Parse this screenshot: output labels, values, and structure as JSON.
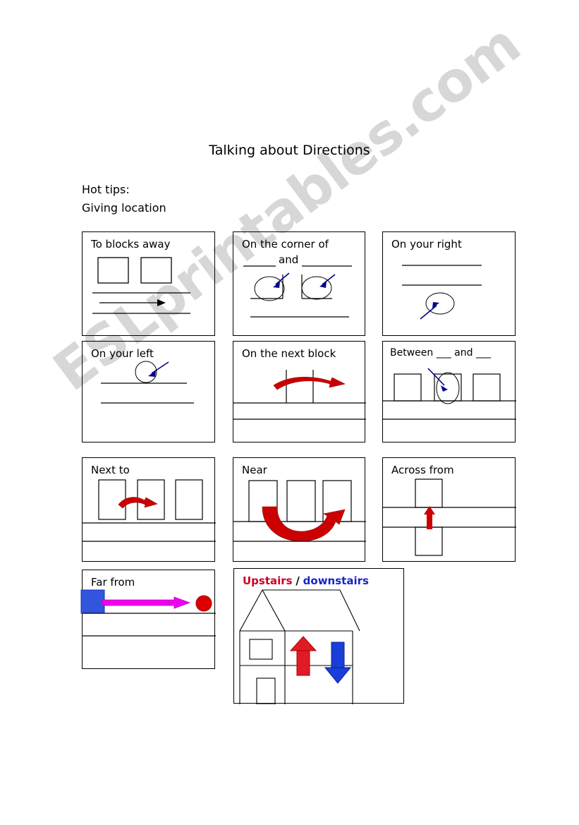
{
  "page": {
    "title": "Talking about Directions",
    "hot_tips_label": "Hot tips:",
    "subtitle": "Giving location",
    "watermark": "ESLprintables.com",
    "background_color": "#ffffff",
    "ink_color": "#000000"
  },
  "colors": {
    "red_arrow": "#cc0000",
    "blue_arrow": "#00008b",
    "magenta_arrow": "#ee00ee",
    "blue_block": "#3355dd",
    "red_circle": "#dd0000",
    "upstairs_text": "#cc0022",
    "downstairs_text": "#1a23c8",
    "watermark_gray": "#c9c9c9"
  },
  "cards": [
    {
      "id": "to-blocks-away",
      "title": "To blocks away",
      "row": 1,
      "column": 1,
      "graphic": "two-blocks-with-street-arrow",
      "description": "Two square blocks above a street with a right-pointing arrow between two road lines"
    },
    {
      "id": "on-the-corner-of",
      "title_line1": "On the corner of",
      "title_line2": "and",
      "title": "On the corner of ___ and ___",
      "row": 1,
      "column": 2,
      "graphic": "two-corners-with-blue-arrows",
      "description": "Two corner blocks each marked with a circle and a blue arrow"
    },
    {
      "id": "on-your-right",
      "title": "On your right",
      "row": 1,
      "column": 3,
      "graphic": "street-with-circle-and-blue-arrow",
      "description": "Two street lines with a circled spot below marked by a blue arrow"
    },
    {
      "id": "on-your-left",
      "title": "On your left",
      "row": 2,
      "column": 1,
      "graphic": "street-with-circle-and-blue-arrow-left",
      "description": "Circle on upper street line marked by a blue arrow"
    },
    {
      "id": "on-the-next-block",
      "title": "On the next block",
      "row": 2,
      "column": 2,
      "graphic": "red-curved-arrow-over-block",
      "description": "Red curved arrow arching over the next block"
    },
    {
      "id": "between-and",
      "title": "Between ___ and ___",
      "row": 2,
      "column": 3,
      "graphic": "three-buildings-with-blue-arrow",
      "description": "Three buildings, a circle around the middle one marked by a blue arrow"
    },
    {
      "id": "next-to",
      "title": "Next to",
      "row": 3,
      "column": 1,
      "graphic": "three-buildings-short-red-arrow",
      "description": "Three buildings with a short red curved arrow pointing from one to the neighbour"
    },
    {
      "id": "near",
      "title": "Near",
      "row": 3,
      "column": 2,
      "graphic": "three-buildings-large-red-u-arrow",
      "description": "Three buildings with a large red U-shaped arrow sweeping under them"
    },
    {
      "id": "across-from",
      "title": "Across from",
      "row": 3,
      "column": 3,
      "graphic": "two-buildings-across-street-red-arrow",
      "description": "Two buildings facing each other across a street with a vertical red arrow"
    },
    {
      "id": "far-from",
      "title": "Far from",
      "row": 4,
      "column": 1,
      "graphic": "blue-block-magenta-arrow-red-circle",
      "description": "Blue block on the left, long magenta arrow pointing right to a red circle"
    },
    {
      "id": "upstairs-downstairs",
      "title_upstairs": "Upstairs",
      "title_separator": "/",
      "title_downstairs": "downstairs",
      "title": "Upstairs / downstairs",
      "row": 4,
      "column": 2,
      "graphic": "house-with-up-and-down-arrows",
      "description": "Two storey house with a red up arrow and a blue down arrow inside"
    }
  ]
}
